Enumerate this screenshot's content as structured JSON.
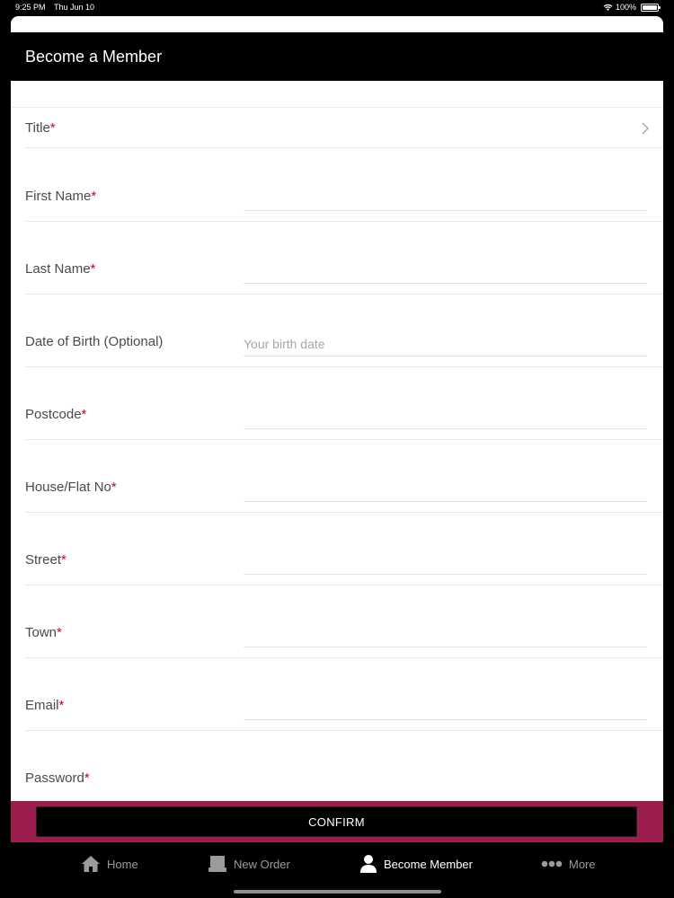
{
  "status": {
    "time": "9:25 PM",
    "date": "Thu Jun 10",
    "battery": "100%"
  },
  "header": {
    "title": "Become a Member"
  },
  "form": {
    "fields": [
      {
        "label": "Title",
        "required": true,
        "type": "select",
        "value": ""
      },
      {
        "label": "First Name",
        "required": true,
        "type": "text",
        "value": "",
        "placeholder": ""
      },
      {
        "label": "Last Name",
        "required": true,
        "type": "text",
        "value": "",
        "placeholder": ""
      },
      {
        "label": "Date of Birth (Optional)",
        "required": false,
        "type": "text",
        "value": "",
        "placeholder": "Your birth date"
      },
      {
        "label": "Postcode",
        "required": true,
        "type": "text",
        "value": "",
        "placeholder": ""
      },
      {
        "label": "House/Flat No",
        "required": true,
        "type": "text",
        "value": "",
        "placeholder": ""
      },
      {
        "label": "Street",
        "required": true,
        "type": "text",
        "value": "",
        "placeholder": ""
      },
      {
        "label": "Town",
        "required": true,
        "type": "text",
        "value": "",
        "placeholder": ""
      },
      {
        "label": "Email",
        "required": true,
        "type": "text",
        "value": "",
        "placeholder": ""
      },
      {
        "label": "Password",
        "required": true,
        "type": "text",
        "value": "",
        "placeholder": ""
      }
    ],
    "required_marker": "*",
    "confirm_label": "CONFIRM"
  },
  "tabs": [
    {
      "label": "Home",
      "icon": "home-icon",
      "active": false
    },
    {
      "label": "New Order",
      "icon": "new-order-icon",
      "active": false
    },
    {
      "label": "Become Member",
      "icon": "member-icon",
      "active": true
    },
    {
      "label": "More",
      "icon": "more-icon",
      "active": false
    }
  ],
  "colors": {
    "accent": "#9c1e4f",
    "required": "#d0021b",
    "background": "#000000"
  }
}
